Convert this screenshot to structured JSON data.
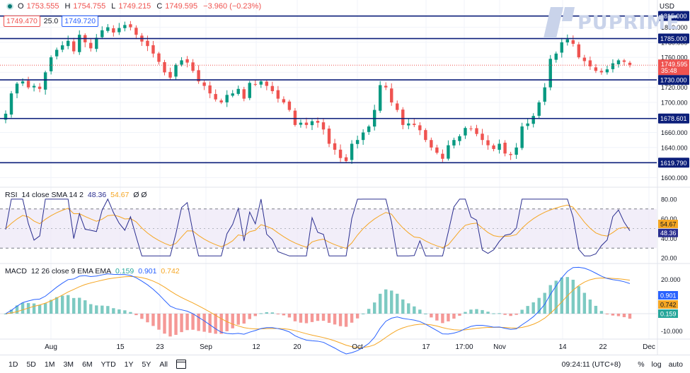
{
  "legend": {
    "open_label": "O",
    "open": "1753.555",
    "high_label": "H",
    "high": "1754.755",
    "low_label": "L",
    "low": "1749.215",
    "close_label": "C",
    "close": "1749.595",
    "change": "−3.960 (−0.23%)",
    "bid": "1749.470",
    "spread": "25.0",
    "ask": "1749.720"
  },
  "currency": "USD",
  "watermark": "PUPRIME",
  "rsi_legend": {
    "name": "RSI",
    "params": "14 close SMA 14 2",
    "rsi": "48.36",
    "ma": "54.67",
    "extra": "Ø Ø"
  },
  "macd_legend": {
    "name": "MACD",
    "params": "12 26 close 9 EMA EMA",
    "hist": "0.159",
    "macd": "0.901",
    "signal": "0.742"
  },
  "bottom": {
    "ranges": [
      "1D",
      "5D",
      "1M",
      "3M",
      "6M",
      "YTD",
      "1Y",
      "5Y",
      "All"
    ],
    "time": "09:24:11 (UTC+8)",
    "percent": "%",
    "log": "log",
    "auto": "auto"
  },
  "colors": {
    "up": "#089981",
    "down": "#ef5350",
    "level": "#0c1f7a",
    "rsi": "#2a2e8f",
    "signal": "#f5a623",
    "macd": "#2962ff",
    "hist_up": "#26a69a",
    "hist_down": "#ef5350"
  },
  "chart_data": {
    "type": "candlestick",
    "x_ticks": [
      "Aug",
      "15",
      "23",
      "Sep",
      "12",
      "20",
      "Oct",
      "17",
      "17:00",
      "Nov",
      "14",
      "22",
      "Dec"
    ],
    "price_ticks": [
      1800.0,
      1780.0,
      1760.0,
      1740.0,
      1720.0,
      1700.0,
      1680.0,
      1660.0,
      1640.0,
      1620.0,
      1600.0
    ],
    "price_ylim": [
      1590,
      1825
    ],
    "horizontal_levels": [
      1815.0,
      1785.0,
      1730.0,
      1678.601,
      1619.79
    ],
    "current_price": "1749.595",
    "countdown": "35:48",
    "closes": [
      1685,
      1712,
      1725,
      1728,
      1720,
      1722,
      1718,
      1740,
      1760,
      1770,
      1776,
      1782,
      1768,
      1790,
      1780,
      1772,
      1786,
      1796,
      1800,
      1793,
      1799,
      1803,
      1800,
      1790,
      1781,
      1775,
      1765,
      1754,
      1740,
      1733,
      1750,
      1756,
      1753,
      1742,
      1728,
      1722,
      1712,
      1704,
      1700,
      1710,
      1712,
      1718,
      1705,
      1726,
      1724,
      1728,
      1722,
      1715,
      1705,
      1700,
      1690,
      1670,
      1673,
      1670,
      1675,
      1673,
      1664,
      1645,
      1637,
      1626,
      1622,
      1645,
      1650,
      1660,
      1668,
      1690,
      1723,
      1720,
      1700,
      1690,
      1670,
      1672,
      1670,
      1663,
      1650,
      1640,
      1633,
      1625,
      1643,
      1650,
      1655,
      1666,
      1665,
      1658,
      1650,
      1643,
      1638,
      1645,
      1632,
      1630,
      1640,
      1668,
      1672,
      1682,
      1700,
      1720,
      1758,
      1765,
      1780,
      1784,
      1778,
      1760,
      1755,
      1748,
      1742,
      1740,
      1744,
      1752,
      1756,
      1754,
      1750
    ],
    "rsi_ticks": [
      80.0,
      60.0,
      40.0,
      20.0
    ],
    "rsi_ylim": [
      15,
      90
    ],
    "rsi_bands": [
      70,
      30
    ],
    "rsi_last": "48.36",
    "rsi_ma_last": "54.67",
    "macd_ticks": [
      20.0,
      0.0,
      -10.0
    ],
    "macd_ylim": [
      -14,
      28
    ],
    "macd_last": "0.901",
    "signal_last": "0.742",
    "hist_last": "0.159"
  }
}
